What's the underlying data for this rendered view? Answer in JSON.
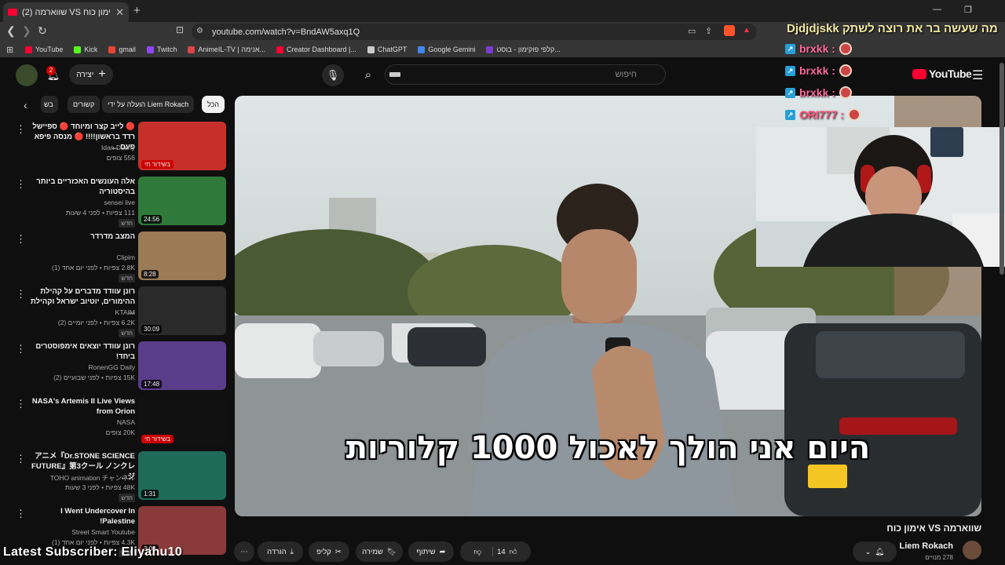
{
  "browser": {
    "tab_title": "(2) שווארמה VS אימון כוח - YouTube",
    "url": "youtube.com/watch?v=BndAW5axq1Q",
    "bookmarks": [
      {
        "label": "YouTube",
        "color": "#ff0033"
      },
      {
        "label": "Kick",
        "color": "#53fc18"
      },
      {
        "label": "gmail",
        "color": "#ea4335"
      },
      {
        "label": "Twitch",
        "color": "#9146ff"
      },
      {
        "label": "AnimeIL-TV | אנימה...",
        "color": "#d44"
      },
      {
        "label": "Creator Dashboard |...",
        "color": "#ff0033"
      },
      {
        "label": "ChatGPT",
        "color": "#ccc"
      },
      {
        "label": "Google Gemini",
        "color": "#4285f4"
      },
      {
        "label": "קלפי פוקימון - בוסט...",
        "color": "#7a3dd4"
      }
    ]
  },
  "header": {
    "search_placeholder": "חיפוש",
    "create_label": "יצירה",
    "notif_count": "2",
    "logo_text": "YouTube"
  },
  "chips": [
    "הכל",
    "הועלה על ידי Liem Rokach",
    "קשורים",
    "בש"
  ],
  "recommendations": [
    {
      "title": "🔴 לייב קצר ומיוחד 🔴 ספיישל רדד בראשון!!!! 🔴 מנסה פיפא פעם ...",
      "channel": "Idan Dushy",
      "meta": "556 צופים",
      "badge": "",
      "overlay": "בשידור חי",
      "thumb": "#c7302a"
    },
    {
      "title": "אלה העונשים האכזריים ביותר בהיסטוריה",
      "channel": "sensei live",
      "meta": "111 צפיות • לפני 4 שעות",
      "badge": "חדש",
      "overlay": "24:56",
      "thumb": "#2f7a3a"
    },
    {
      "title": "המצב מדרדר",
      "channel": "Clipim",
      "meta": "2.8K צפיות • לפני יום אחד (1)",
      "badge": "חדש",
      "overlay": "8:28",
      "thumb": "#9a7b56"
    },
    {
      "title": "רונן עוודד מדברים על קהילת ההימורים, יוטיוב ישראל וקהילת ...",
      "channel": "KTAIM",
      "meta": "6.2K צפיות • לפני יומיים (2)",
      "badge": "חדש",
      "overlay": "30:09",
      "thumb": "#2a2a2a"
    },
    {
      "title": "רונן עוודד יוצאים אימפוסטרים ביחד!",
      "channel": "RonenGG Daily",
      "meta": "15K צפיות • לפני שבועיים (2)",
      "badge": "",
      "overlay": "17:48",
      "thumb": "#5a3d8a"
    },
    {
      "title": "NASA's Artemis II Live Views from Orion",
      "channel": "NASA",
      "meta": "20K צופים",
      "badge": "",
      "overlay": "בשידור חי",
      "thumb": "#111111"
    },
    {
      "title": "アニメ『Dr.STONE SCIENCE FUTURE』第3クール ノンクレジ...",
      "channel": "TOHO animation チャンネル",
      "meta": "48K צפיות • לפני 3 שעות",
      "badge": "חדש",
      "overlay": "1:31",
      "thumb": "#1f6b5a"
    },
    {
      "title": "I Went Undercover In Palestine!",
      "channel": "Street Smart Youtube",
      "meta": "4.3K צפיות • לפני יום אחד (1)",
      "badge": "חדש",
      "overlay": "3:08",
      "thumb": "#8a3a3a"
    }
  ],
  "video": {
    "subtitle": "היום אני הולך לאכול 1000 קלוריות",
    "title": "שווארמה VS אימון כוח",
    "channel": "Liem Rokach",
    "subscribers": "278 מנויים",
    "likes": "14",
    "share_label": "שיתוף",
    "save_label": "שמירה",
    "clip_label": "קליפ",
    "download_label": "הורדה"
  },
  "stream_overlay": {
    "chat_header": "Djdjdjskk מה שעשה בר את רוצה לשתק",
    "chat_users": [
      "brxkk :",
      "brxkk :",
      "brxkk :",
      "ORI777 :"
    ],
    "chat_colors": [
      "#ff6b9d",
      "#ff6b9d",
      "#ff6b9d",
      "#ff4f7a"
    ],
    "latest_subscriber": "Latest Subscriber: Eliyahu10"
  }
}
